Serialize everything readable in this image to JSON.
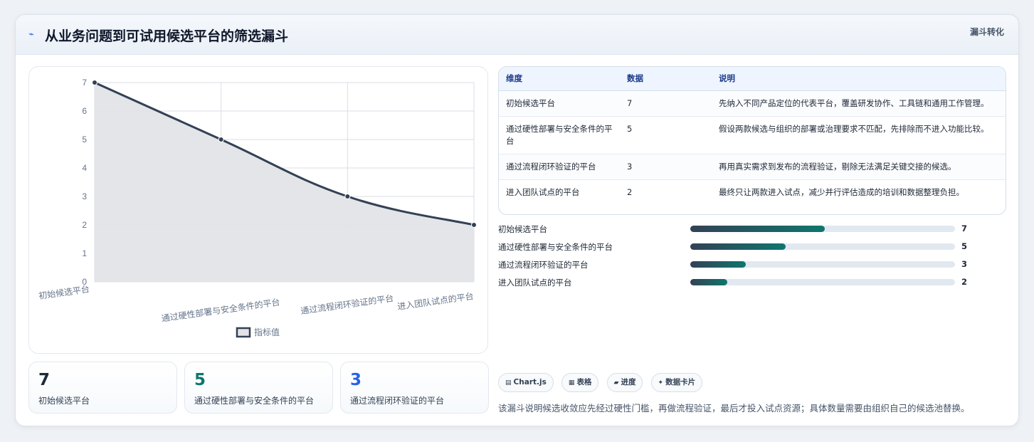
{
  "header": {
    "icon": "trend-line-icon",
    "title": "从业务问题到可试用候选平台的筛选漏斗",
    "tag": "漏斗转化"
  },
  "chart_data": {
    "type": "area",
    "categories": [
      "初始候选平台",
      "通过硬性部署与安全条件的平台",
      "通过流程闭环验证的平台",
      "进入团队试点的平台"
    ],
    "series": [
      {
        "name": "指标值",
        "values": [
          7,
          5,
          3,
          2
        ]
      }
    ],
    "yticks": [
      "0",
      "1",
      "2",
      "3",
      "4",
      "5",
      "6",
      "7"
    ],
    "ylim": [
      0,
      7
    ],
    "grid": true,
    "legend": "bottom",
    "colors": {
      "line": "#334155",
      "fill": "#e2e4e7",
      "grid": "#d8dee6"
    }
  },
  "stats": [
    {
      "value": "7",
      "label": "初始候选平台",
      "color": "#1e293b"
    },
    {
      "value": "5",
      "label": "通过硬性部署与安全条件的平台",
      "color": "#0f766e"
    },
    {
      "value": "3",
      "label": "通过流程闭环验证的平台",
      "color": "#2563eb"
    }
  ],
  "table": {
    "headers": [
      "维度",
      "数据",
      "说明"
    ],
    "rows": [
      [
        "初始候选平台",
        "7",
        "先纳入不同产品定位的代表平台，覆盖研发协作、工具链和通用工作管理。"
      ],
      [
        "通过硬性部署与安全条件的平台",
        "5",
        "假设两款候选与组织的部署或治理要求不匹配，先排除而不进入功能比较。"
      ],
      [
        "通过流程闭环验证的平台",
        "3",
        "再用真实需求到发布的流程验证，剔除无法满足关键交接的候选。"
      ],
      [
        "进入团队试点的平台",
        "2",
        "最终只让两款进入试点，减少并行评估造成的培训和数据整理负担。"
      ]
    ]
  },
  "bars": [
    {
      "label": "初始候选平台",
      "value": "7",
      "fill": 0.507
    },
    {
      "label": "通过硬性部署与安全条件的平台",
      "value": "5",
      "fill": 0.36
    },
    {
      "label": "通过流程闭环验证的平台",
      "value": "3",
      "fill": 0.21
    },
    {
      "label": "进入团队试点的平台",
      "value": "2",
      "fill": 0.14
    }
  ],
  "chips": [
    {
      "icon": "chart-icon",
      "glyph": "▤",
      "label": "Chart.js"
    },
    {
      "icon": "table-icon",
      "glyph": "▦",
      "label": "表格"
    },
    {
      "icon": "progress-icon",
      "glyph": "▰",
      "label": "进度"
    },
    {
      "icon": "card-icon",
      "glyph": "✦",
      "label": "数据卡片"
    }
  ],
  "footnote": "该漏斗说明候选收敛应先经过硬性门槛，再做流程验证，最后才投入试点资源；具体数量需要由组织自己的候选池替换。"
}
